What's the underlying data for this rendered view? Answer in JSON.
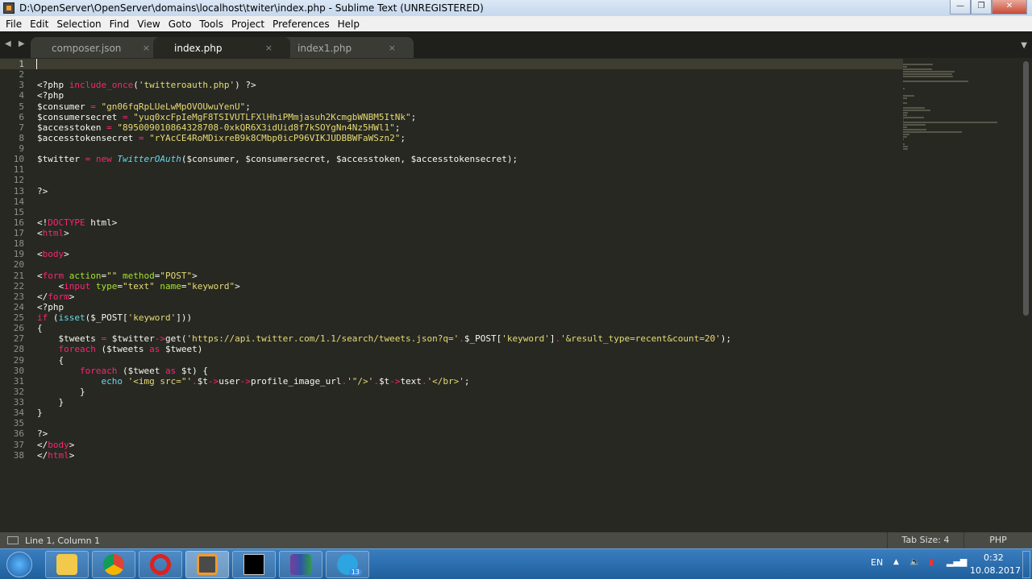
{
  "window": {
    "title": "D:\\OpenServer\\OpenServer\\domains\\localhost\\twiter\\index.php - Sublime Text (UNREGISTERED)",
    "minimize": "—",
    "maximize": "❐",
    "close": "✕"
  },
  "menu": [
    "File",
    "Edit",
    "Selection",
    "Find",
    "View",
    "Goto",
    "Tools",
    "Project",
    "Preferences",
    "Help"
  ],
  "tabs": [
    {
      "label": "composer.json",
      "active": false
    },
    {
      "label": "index.php",
      "active": true
    },
    {
      "label": "index1.php",
      "active": false
    }
  ],
  "tab_close": "×",
  "nav_arrows": "◀ ▶",
  "tab_menu": "▼",
  "code": [
    [],
    [],
    [
      [
        "t",
        "<?php "
      ],
      [
        "k",
        "include_once"
      ],
      [
        "t",
        "("
      ],
      [
        "s",
        "'twitteroauth.php'"
      ],
      [
        "t",
        ") ?>"
      ]
    ],
    [
      [
        "t",
        "<?php"
      ]
    ],
    [
      [
        "t",
        "$consumer "
      ],
      [
        "k",
        "="
      ],
      [
        "t",
        " "
      ],
      [
        "s",
        "\"gn06fqRpLUeLwMpOVOUwuYenU\""
      ],
      [
        "t",
        ";"
      ]
    ],
    [
      [
        "t",
        "$consumersecret "
      ],
      [
        "k",
        "="
      ],
      [
        "t",
        " "
      ],
      [
        "s",
        "\"yuq0xcFpIeMgF8TSIVUTLFXlHhiPMmjasuh2KcmgbWNBM5ItNk\""
      ],
      [
        "t",
        ";"
      ]
    ],
    [
      [
        "t",
        "$accesstoken "
      ],
      [
        "k",
        "="
      ],
      [
        "t",
        " "
      ],
      [
        "s",
        "\"895009010864328708-0xkQR6X3idUid8f7kSOYgNn4Nz5HWl1\""
      ],
      [
        "t",
        ";"
      ]
    ],
    [
      [
        "t",
        "$accesstokensecret "
      ],
      [
        "k",
        "="
      ],
      [
        "t",
        " "
      ],
      [
        "s",
        "\"rYAcCE4RoMDixreB9k8CMbp0icP96VIKJUDBBWFaWSzn2\""
      ],
      [
        "t",
        ";"
      ]
    ],
    [],
    [
      [
        "t",
        "$twitter "
      ],
      [
        "k",
        "="
      ],
      [
        "t",
        " "
      ],
      [
        "k",
        "new"
      ],
      [
        "t",
        " "
      ],
      [
        "c",
        "TwitterOAuth"
      ],
      [
        "t",
        "($consumer, $consumersecret, $accesstoken, $accesstokensecret);"
      ]
    ],
    [],
    [],
    [
      [
        "t",
        "?>"
      ]
    ],
    [],
    [],
    [
      [
        "t",
        "<!"
      ],
      [
        "k",
        "DOCTYPE"
      ],
      [
        "t",
        " html>"
      ]
    ],
    [
      [
        "t",
        "<"
      ],
      [
        "k",
        "html"
      ],
      [
        "t",
        ">"
      ]
    ],
    [],
    [
      [
        "t",
        "<"
      ],
      [
        "k",
        "body"
      ],
      [
        "t",
        ">"
      ]
    ],
    [],
    [
      [
        "t",
        "<"
      ],
      [
        "k",
        "form"
      ],
      [
        "t",
        " "
      ],
      [
        "a",
        "action"
      ],
      [
        "t",
        "="
      ],
      [
        "s",
        "\"\""
      ],
      [
        "t",
        " "
      ],
      [
        "a",
        "method"
      ],
      [
        "t",
        "="
      ],
      [
        "s",
        "\"POST\""
      ],
      [
        "t",
        ">"
      ]
    ],
    [
      [
        "t",
        "    <"
      ],
      [
        "k",
        "input"
      ],
      [
        "t",
        " "
      ],
      [
        "a",
        "type"
      ],
      [
        "t",
        "="
      ],
      [
        "s",
        "\"text\""
      ],
      [
        "t",
        " "
      ],
      [
        "a",
        "name"
      ],
      [
        "t",
        "="
      ],
      [
        "s",
        "\"keyword\""
      ],
      [
        "t",
        ">"
      ]
    ],
    [
      [
        "t",
        "</"
      ],
      [
        "k",
        "form"
      ],
      [
        "t",
        ">"
      ]
    ],
    [
      [
        "t",
        "<?php"
      ]
    ],
    [
      [
        "k",
        "if"
      ],
      [
        "t",
        " ("
      ],
      [
        "f",
        "isset"
      ],
      [
        "t",
        "($_POST["
      ],
      [
        "s",
        "'keyword'"
      ],
      [
        "t",
        "]))"
      ]
    ],
    [
      [
        "t",
        "{"
      ]
    ],
    [
      [
        "t",
        "    $tweets "
      ],
      [
        "k",
        "="
      ],
      [
        "t",
        " $twitter"
      ],
      [
        "k",
        "->"
      ],
      [
        "t",
        "get("
      ],
      [
        "s",
        "'https://api.twitter.com/1.1/search/tweets.json?q='"
      ],
      [
        "k",
        "."
      ],
      [
        "t",
        "$_POST["
      ],
      [
        "s",
        "'keyword'"
      ],
      [
        "t",
        "]"
      ],
      [
        "k",
        "."
      ],
      [
        "s",
        "'&result_type=recent&count=20'"
      ],
      [
        "t",
        ");"
      ]
    ],
    [
      [
        "t",
        "    "
      ],
      [
        "k",
        "foreach"
      ],
      [
        "t",
        " ($tweets "
      ],
      [
        "k",
        "as"
      ],
      [
        "t",
        " $tweet)"
      ]
    ],
    [
      [
        "t",
        "    {"
      ]
    ],
    [
      [
        "t",
        "        "
      ],
      [
        "k",
        "foreach"
      ],
      [
        "t",
        " ($tweet "
      ],
      [
        "k",
        "as"
      ],
      [
        "t",
        " $t) {"
      ]
    ],
    [
      [
        "t",
        "            "
      ],
      [
        "f",
        "echo"
      ],
      [
        "t",
        " "
      ],
      [
        "s",
        "'<img src=\"'"
      ],
      [
        "k",
        "."
      ],
      [
        "t",
        "$t"
      ],
      [
        "k",
        "->"
      ],
      [
        "t",
        "user"
      ],
      [
        "k",
        "->"
      ],
      [
        "t",
        "profile_image_url"
      ],
      [
        "k",
        "."
      ],
      [
        "s",
        "'\"/>'"
      ],
      [
        "k",
        "."
      ],
      [
        "t",
        "$t"
      ],
      [
        "k",
        "->"
      ],
      [
        "t",
        "text"
      ],
      [
        "k",
        "."
      ],
      [
        "s",
        "'</br>'"
      ],
      [
        "t",
        ";"
      ]
    ],
    [
      [
        "t",
        "        }"
      ]
    ],
    [
      [
        "t",
        "    }"
      ]
    ],
    [
      [
        "t",
        "}"
      ]
    ],
    [],
    [
      [
        "t",
        "?>"
      ]
    ],
    [
      [
        "t",
        "</"
      ],
      [
        "k",
        "body"
      ],
      [
        "t",
        ">"
      ]
    ],
    [
      [
        "t",
        "</"
      ],
      [
        "k",
        "html"
      ],
      [
        "t",
        ">"
      ]
    ]
  ],
  "status": {
    "position": "Line 1, Column 1",
    "tab_size": "Tab Size: 4",
    "syntax": "PHP"
  },
  "taskbar": {
    "apps": [
      "explorer",
      "chrome",
      "opera",
      "sublime-text",
      "cmd",
      "winrar",
      "telegram"
    ],
    "telegram_badge": "13",
    "lang": "EN",
    "time": "0:32",
    "date": "10.08.2017"
  }
}
